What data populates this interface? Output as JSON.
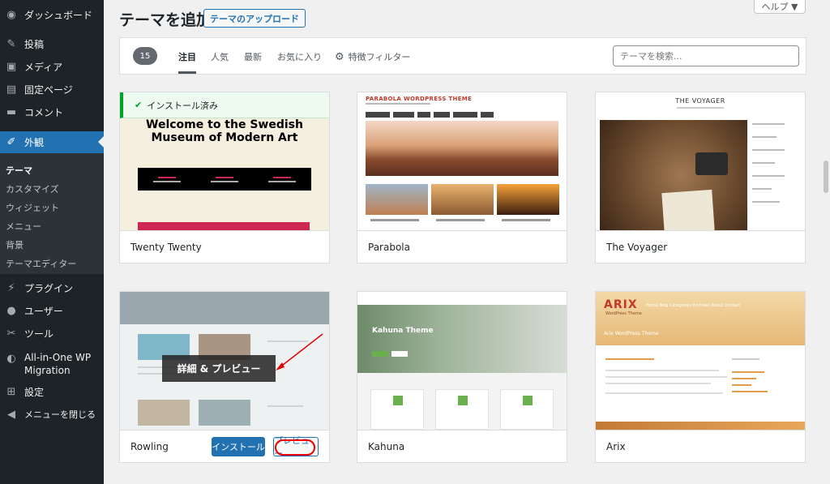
{
  "sidebar": {
    "dashboard": "ダッシュボード",
    "posts": "投稿",
    "media": "メディア",
    "pages": "固定ページ",
    "comments": "コメント",
    "appearance": "外観",
    "submenu": [
      "テーマ",
      "カスタマイズ",
      "ウィジェット",
      "メニュー",
      "背景",
      "テーマエディター"
    ],
    "plugins": "プラグイン",
    "users": "ユーザー",
    "tools": "ツール",
    "migration_line1": "All-in-One WP",
    "migration_line2": "Migration",
    "settings": "設定",
    "collapse": "メニューを閉じる"
  },
  "header": {
    "title": "テーマを追加",
    "upload_label": "テーマのアップロード",
    "help_label": "ヘルプ ▼"
  },
  "filter_bar": {
    "count": "15",
    "tabs": [
      "注目",
      "人気",
      "最新",
      "お気に入り"
    ],
    "feature_filter": "特徴フィルター",
    "search_placeholder": "テーマを検索..."
  },
  "themes": {
    "twenty_twenty": {
      "name": "Twenty Twenty",
      "installed_label": "インストール済み",
      "heading": "Welcome to the Swedish Museum of Modern Art"
    },
    "parabola": {
      "name": "Parabola",
      "header_text": "PARABOLA WORDPRESS THEME"
    },
    "voyager": {
      "name": "The Voyager",
      "header_text": "THE VOYAGER"
    },
    "rowling": {
      "name": "Rowling",
      "overlay_label": "詳細 & プレビュー",
      "install_label": "インストール",
      "preview_label": "プレビュー"
    },
    "kahuna": {
      "name": "Kahuna",
      "hero_text": "Kahuna Theme"
    },
    "arix": {
      "name": "Arix",
      "logo_text": "ARIX",
      "logo_sub": "WordPress Theme",
      "nav_text": "Home  Blog  Categories  Archives  About  Contact",
      "tagline": "Arix WordPress Theme"
    }
  },
  "colors": {
    "sidebar_bg": "#1d2327",
    "accent": "#2271b1",
    "installed_green": "#00a32a",
    "annotation_red": "#e00000"
  }
}
